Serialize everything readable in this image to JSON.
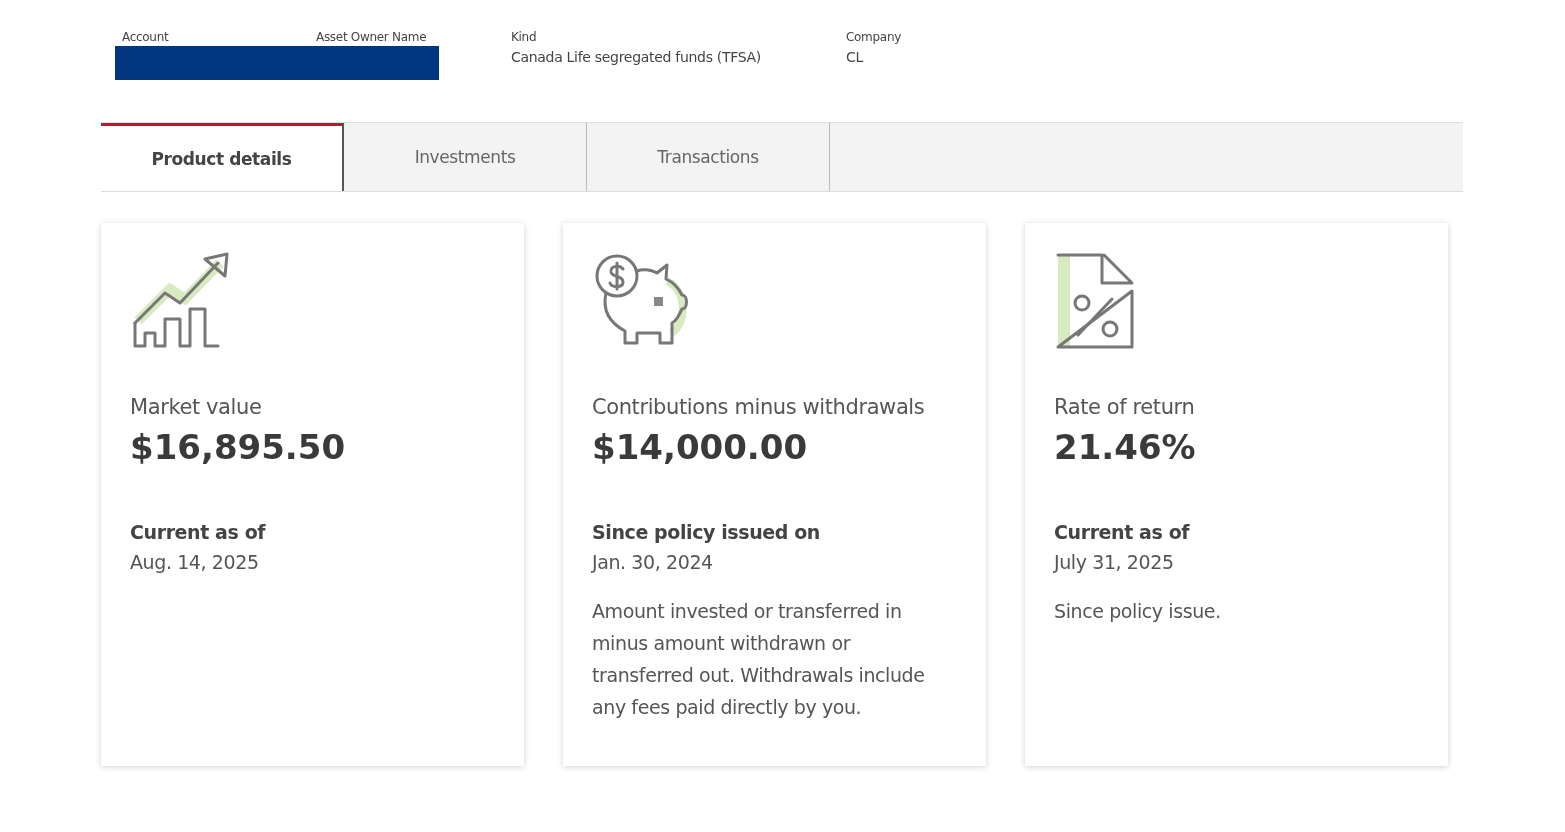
{
  "header": {
    "fields": [
      {
        "label": "Account",
        "redacted": true
      },
      {
        "label": "Asset Owner Name",
        "redacted": true
      },
      {
        "label": "Kind",
        "value": "Canada Life segregated funds (TFSA)"
      },
      {
        "label": "Company",
        "value": "CL"
      }
    ]
  },
  "tabs": [
    {
      "label": "Product details",
      "selected": true
    },
    {
      "label": "Investments",
      "selected": false
    },
    {
      "label": "Transactions",
      "selected": false
    }
  ],
  "cards": [
    {
      "kind": "growth",
      "title": "Market value",
      "amount": "$16,895.50",
      "note_label": "Current as of",
      "note_date": "Aug. 14, 2025"
    },
    {
      "kind": "savings",
      "title": "Contributions minus withdrawals",
      "amount": "$14,000.00",
      "note_label": "Since policy issued on",
      "note_date": "Jan. 30, 2024",
      "description": "Amount invested or transferred in minus amount withdrawn or transferred out. Withdrawals include any fees paid directly by you."
    },
    {
      "kind": "rate",
      "title": "Rate of return",
      "amount": "21.46%",
      "note_label": "Current as of",
      "note_date": "July 31, 2025",
      "description": "Since policy issue."
    }
  ]
}
